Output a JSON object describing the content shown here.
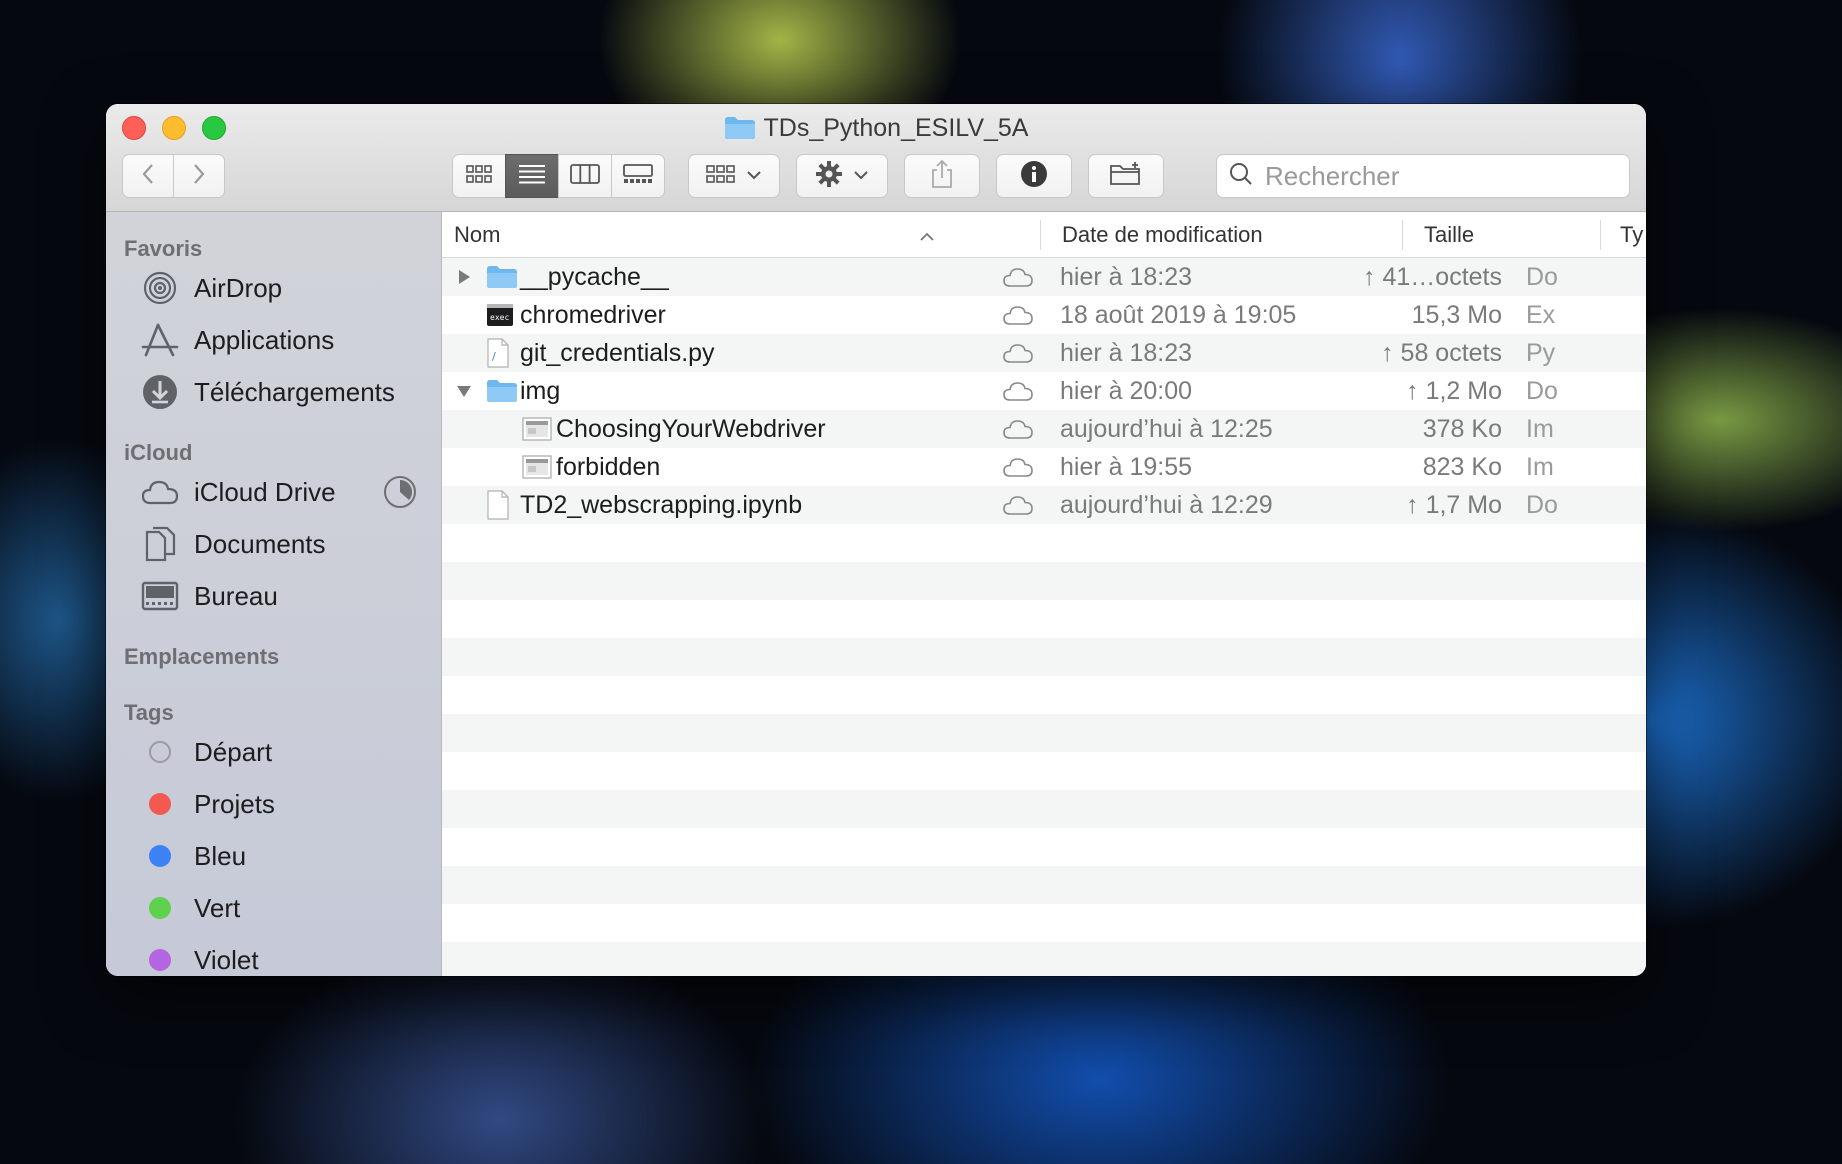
{
  "window": {
    "title": "TDs_Python_ESILV_5A"
  },
  "toolbar": {
    "back_icon": "chevron-left-icon",
    "forward_icon": "chevron-right-icon",
    "views": [
      "icon-view",
      "list-view",
      "column-view",
      "gallery-view"
    ],
    "active_view": "list-view",
    "search_placeholder": "Rechercher"
  },
  "sidebar": {
    "sections": {
      "favoris": "Favoris",
      "icloud": "iCloud",
      "emplacements": "Emplacements",
      "tags": "Tags"
    },
    "favoris": [
      {
        "label": "AirDrop",
        "icon": "airdrop-icon"
      },
      {
        "label": "Applications",
        "icon": "applications-icon"
      },
      {
        "label": "Téléchargements",
        "icon": "download-icon"
      }
    ],
    "icloud": [
      {
        "label": "iCloud Drive",
        "icon": "cloud-icon"
      },
      {
        "label": "Documents",
        "icon": "documents-icon"
      },
      {
        "label": "Bureau",
        "icon": "desktop-icon"
      }
    ],
    "tags": [
      {
        "label": "Départ",
        "color": "#c8c8cc"
      },
      {
        "label": "Projets",
        "color": "#f25a4f"
      },
      {
        "label": "Bleu",
        "color": "#3c82f6"
      },
      {
        "label": "Vert",
        "color": "#5fd14d"
      },
      {
        "label": "Violet",
        "color": "#b366e0"
      }
    ]
  },
  "columns": {
    "name": "Nom",
    "date": "Date de modification",
    "size": "Taille",
    "kind": "Ty"
  },
  "files": [
    {
      "name": "__pycache__",
      "date": "hier à 18:23",
      "size": "↑ 41…octets",
      "kind": "Do",
      "type": "folder",
      "expander": "collapsed",
      "depth": 0
    },
    {
      "name": "chromedriver",
      "date": "18 août 2019 à 19:05",
      "size": "15,3 Mo",
      "kind": "Ex",
      "type": "exec",
      "expander": "none",
      "depth": 0
    },
    {
      "name": "git_credentials.py",
      "date": "hier à 18:23",
      "size": "↑ 58 octets",
      "kind": "Py",
      "type": "python",
      "expander": "none",
      "depth": 0
    },
    {
      "name": "img",
      "date": "hier à 20:00",
      "size": "↑ 1,2 Mo",
      "kind": "Do",
      "type": "folder",
      "expander": "expanded",
      "depth": 0
    },
    {
      "name": "ChoosingYourWebdriver",
      "date": "aujourd’hui à 12:25",
      "size": "378 Ko",
      "kind": "Im",
      "type": "image",
      "expander": "none",
      "depth": 1
    },
    {
      "name": "forbidden",
      "date": "hier à 19:55",
      "size": "823 Ko",
      "kind": "Im",
      "type": "image",
      "expander": "none",
      "depth": 1
    },
    {
      "name": "TD2_webscrapping.ipynb",
      "date": "aujourd’hui à 12:29",
      "size": "↑ 1,7 Mo",
      "kind": "Do",
      "type": "document",
      "expander": "none",
      "depth": 0
    }
  ],
  "empty_rows": 12
}
